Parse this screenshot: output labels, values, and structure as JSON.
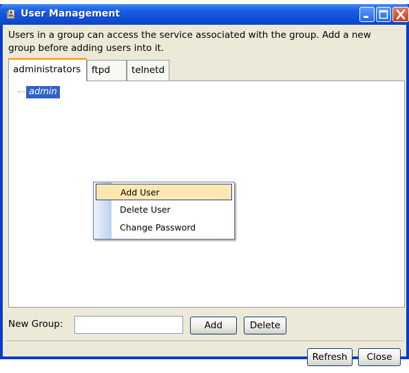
{
  "window": {
    "title": "User Management",
    "colors": {
      "titlebar": "#0f4fd6",
      "client_bg": "#ece9d8",
      "selection": "#2f62c7",
      "menu_highlight": "#ffe8b0",
      "active_tab_accent": "#f8a838"
    }
  },
  "description": {
    "line1": "Users in a group can access the service associated with the group. Add a new",
    "line2": "group before adding users into it."
  },
  "tabs": [
    {
      "label": "administrators",
      "active": true
    },
    {
      "label": "ftpd",
      "active": false
    },
    {
      "label": "telnetd",
      "active": false
    }
  ],
  "tree": {
    "selected_user": "admin"
  },
  "context_menu": {
    "items": [
      {
        "label": "Add User",
        "highlighted": true
      },
      {
        "label": "Delete User",
        "highlighted": false
      },
      {
        "label": "Change Password",
        "highlighted": false
      }
    ]
  },
  "new_group": {
    "label": "New Group:",
    "value": "",
    "add_label": "Add",
    "delete_label": "Delete"
  },
  "footer": {
    "refresh_label": "Refresh",
    "close_label": "Close"
  },
  "icons": [
    "app-icon",
    "minimize-icon",
    "maximize-icon",
    "close-icon"
  ]
}
